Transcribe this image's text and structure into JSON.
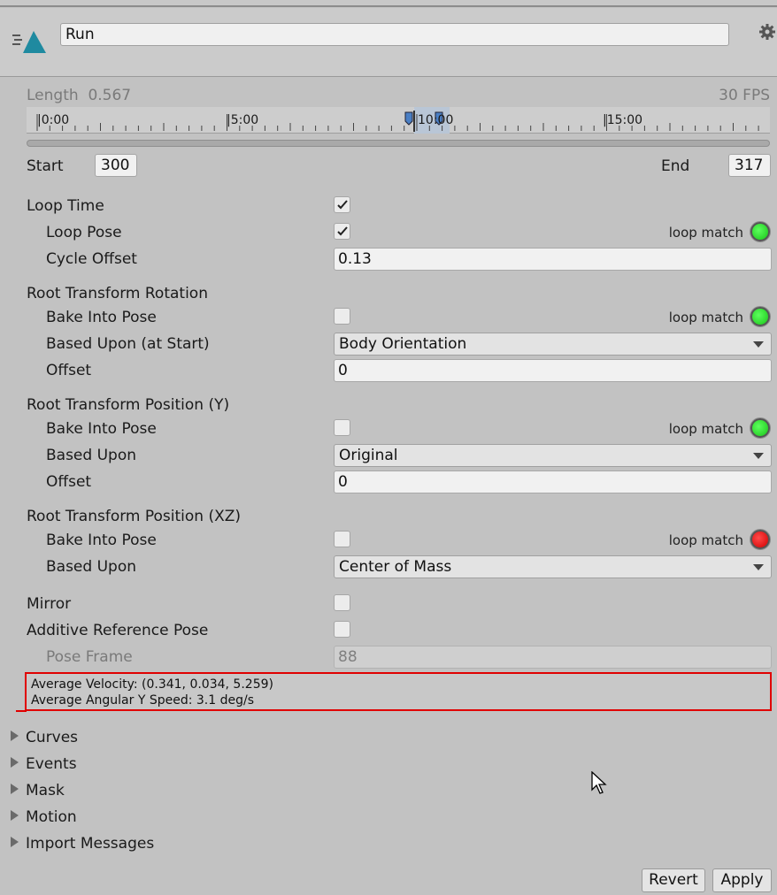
{
  "clip_name": "Run",
  "length_label": "Length",
  "length_value": "0.567",
  "fps": "30 FPS",
  "timeline_ticks": [
    "|0:00",
    "|5:00",
    "10:00",
    "|15:00"
  ],
  "start_label": "Start",
  "start_value": "300",
  "end_label": "End",
  "end_value": "317",
  "loop_time": {
    "label": "Loop Time",
    "checked": true
  },
  "loop_pose": {
    "label": "Loop Pose",
    "checked": true,
    "match": "loop match",
    "status": "green"
  },
  "cycle_offset": {
    "label": "Cycle Offset",
    "value": "0.13"
  },
  "root_rotation": {
    "header": "Root Transform Rotation",
    "bake_label": "Bake Into Pose",
    "bake_checked": false,
    "match": "loop match",
    "status": "green",
    "based_label": "Based Upon (at Start)",
    "based_value": "Body Orientation",
    "offset_label": "Offset",
    "offset_value": "0"
  },
  "root_pos_y": {
    "header": "Root Transform Position (Y)",
    "bake_label": "Bake Into Pose",
    "bake_checked": false,
    "match": "loop match",
    "status": "green",
    "based_label": "Based Upon",
    "based_value": "Original",
    "offset_label": "Offset",
    "offset_value": "0"
  },
  "root_pos_xz": {
    "header": "Root Transform Position (XZ)",
    "bake_label": "Bake Into Pose",
    "bake_checked": false,
    "match": "loop match",
    "status": "red",
    "based_label": "Based Upon",
    "based_value": "Center of Mass"
  },
  "mirror": {
    "label": "Mirror",
    "checked": false
  },
  "additive": {
    "label": "Additive Reference Pose",
    "checked": false
  },
  "pose_frame": {
    "label": "Pose Frame",
    "value": "88"
  },
  "info": {
    "velocity": "Average Velocity: (0.341, 0.034, 5.259)",
    "angular": "Average Angular Y Speed: 3.1 deg/s"
  },
  "foldouts": [
    "Curves",
    "Events",
    "Mask",
    "Motion",
    "Import Messages"
  ],
  "buttons": {
    "revert": "Revert",
    "apply": "Apply"
  },
  "colors": {
    "accent_icon": "#1f8aa0",
    "match_green": "#22cc22",
    "match_red": "#e00000",
    "info_border": "#e00000"
  }
}
